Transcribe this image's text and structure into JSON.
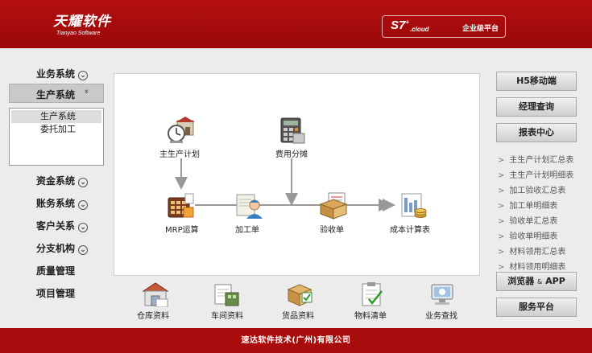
{
  "header": {
    "logo_cn": "天耀软件",
    "logo_en": "Tianyao Software",
    "cloud_brand": "S7",
    "cloud_plus": "+",
    "cloud_sub": ".cloud",
    "cloud_platform": "企业级平台"
  },
  "sidebar": {
    "items": [
      {
        "label": "业务系统",
        "expandable": true
      },
      {
        "label": "生产系统",
        "expandable": true,
        "active": true
      },
      {
        "label": "资金系统",
        "expandable": true
      },
      {
        "label": "账务系统",
        "expandable": true
      },
      {
        "label": "客户关系",
        "expandable": true
      },
      {
        "label": "分支机构",
        "expandable": true
      },
      {
        "label": "质量管理",
        "expandable": false
      },
      {
        "label": "项目管理",
        "expandable": false
      }
    ],
    "submenu": [
      "生产系统",
      "委托加工"
    ],
    "chevron_glyph": "»"
  },
  "flow": {
    "nodes": {
      "main_plan": "主生产计划",
      "cost_alloc": "费用分摊",
      "mrp": "MRP运算",
      "process_order": "加工单",
      "inspection": "验收单",
      "cost_calc": "成本计算表"
    }
  },
  "bottom_icons": [
    "仓库资料",
    "车间资料",
    "货品资料",
    "物料清单",
    "业务查找"
  ],
  "right_panel": {
    "buttons_top": [
      "H5移动端",
      "经理查询",
      "报表中心"
    ],
    "report_links": [
      "主生产计划汇总表",
      "主生产计划明细表",
      "加工验收汇总表",
      "加工单明细表",
      "验收单汇总表",
      "验收单明细表",
      "材料领用汇总表",
      "材料领用明细表"
    ],
    "browser_app_main": "浏览器",
    "browser_app_amp": "&",
    "browser_app_suffix": "APP",
    "service_platform": "服务平台"
  },
  "footer": {
    "text": "速达软件技术(广州)有限公司"
  },
  "colors": {
    "brand_red": "#b40f0f",
    "footer_red": "#a80c0c",
    "background": "#ececec"
  }
}
